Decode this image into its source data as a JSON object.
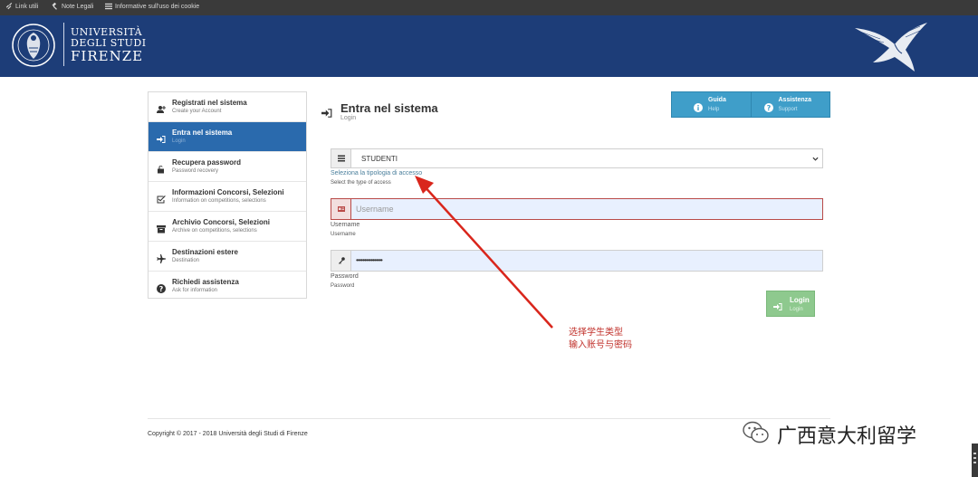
{
  "topbar": {
    "links": [
      {
        "label": "Link utili",
        "icon": "link-icon"
      },
      {
        "label": "Note Legali",
        "icon": "gavel-icon"
      },
      {
        "label": "Informative sull'uso dei cookie",
        "icon": "list-icon"
      }
    ]
  },
  "header": {
    "line1": "UNIVERSITÀ",
    "line2": "DEGLI STUDI",
    "line3": "FIRENZE",
    "bg_color": "#1d3d78"
  },
  "sidebar": {
    "items": [
      {
        "title": "Registrati nel sistema",
        "subtitle": "Create your Account",
        "icon": "user-plus-icon"
      },
      {
        "title": "Entra nel sistema",
        "subtitle": "Login",
        "icon": "sign-in-icon",
        "active": true
      },
      {
        "title": "Recupera password",
        "subtitle": "Password recovery",
        "icon": "unlock-icon"
      },
      {
        "title": "Informazioni Concorsi, Selezioni",
        "subtitle": "Information on competitions, selections",
        "icon": "checkbox-icon"
      },
      {
        "title": "Archivio Concorsi, Selezioni",
        "subtitle": "Archive on competitions, selections",
        "icon": "archive-icon"
      },
      {
        "title": "Destinazioni estere",
        "subtitle": "Destination",
        "icon": "plane-icon"
      },
      {
        "title": "Richiedi assistenza",
        "subtitle": "Ask for information",
        "icon": "question-circle-icon"
      }
    ],
    "active_color": "#2a6aad"
  },
  "main": {
    "title": "Entra nel sistema",
    "subtitle": "Login"
  },
  "help_buttons": [
    {
      "title": "Guida",
      "subtitle": "Help",
      "icon": "info-circle-icon"
    },
    {
      "title": "Assistenza",
      "subtitle": "Support",
      "icon": "question-circle-icon"
    }
  ],
  "form": {
    "access_type": {
      "value": "STUDENTI",
      "hint": "Seleziona la tipologia di accesso",
      "hint_en": "Select the type of access"
    },
    "username": {
      "placeholder": "Username",
      "label": "Username",
      "label_en": "Username"
    },
    "password": {
      "value": "••••••••••••••••",
      "label": "Password",
      "label_en": "Password"
    },
    "login_button": {
      "title": "Login",
      "subtitle": "Login"
    }
  },
  "annotation": {
    "line1": "选择学生类型",
    "line2": "输入账号与密码",
    "color": "#c0302a"
  },
  "footer": {
    "copyright": "Copyright © 2017 - 2018 Università degli Studi di Firenze"
  },
  "watermark": {
    "text": "广西意大利留学"
  }
}
